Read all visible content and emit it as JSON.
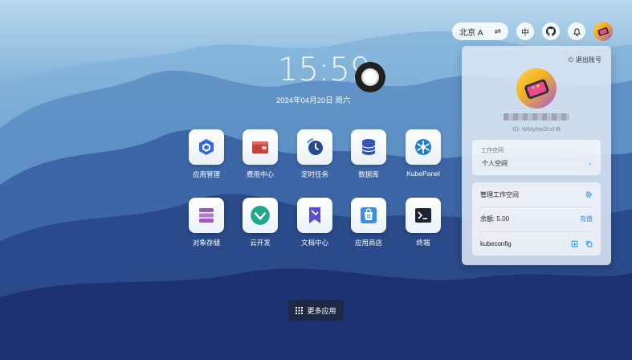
{
  "topbar": {
    "region": "北京 A",
    "language": "中",
    "github_icon": "github-icon",
    "bell_icon": "bell-icon"
  },
  "clock": {
    "time": "15:59",
    "date": "2024年04月20日 周六"
  },
  "apps": [
    {
      "label": "应用管理",
      "icon": "app-manage-icon"
    },
    {
      "label": "费用中心",
      "icon": "wallet-icon"
    },
    {
      "label": "定时任务",
      "icon": "timer-icon"
    },
    {
      "label": "数据库",
      "icon": "database-icon"
    },
    {
      "label": "KubePanel",
      "icon": "kubepanel-icon"
    },
    {
      "label": "对象存储",
      "icon": "storage-icon"
    },
    {
      "label": "云开发",
      "icon": "cloud-dev-icon"
    },
    {
      "label": "文档中心",
      "icon": "docs-icon"
    },
    {
      "label": "应用商店",
      "icon": "app-store-icon"
    },
    {
      "label": "终端",
      "icon": "terminal-icon"
    }
  ],
  "more_apps": "更多应用",
  "panel": {
    "logout": "退出账号",
    "user_id": "ID: W6lyhwl2cd",
    "workspace": {
      "title": "工作空间",
      "current": "个人空间"
    },
    "manage_workspace": "管理工作空间",
    "balance_label": "余额: 5.00",
    "recharge": "充值",
    "kubeconfig": "kubeconfig"
  }
}
